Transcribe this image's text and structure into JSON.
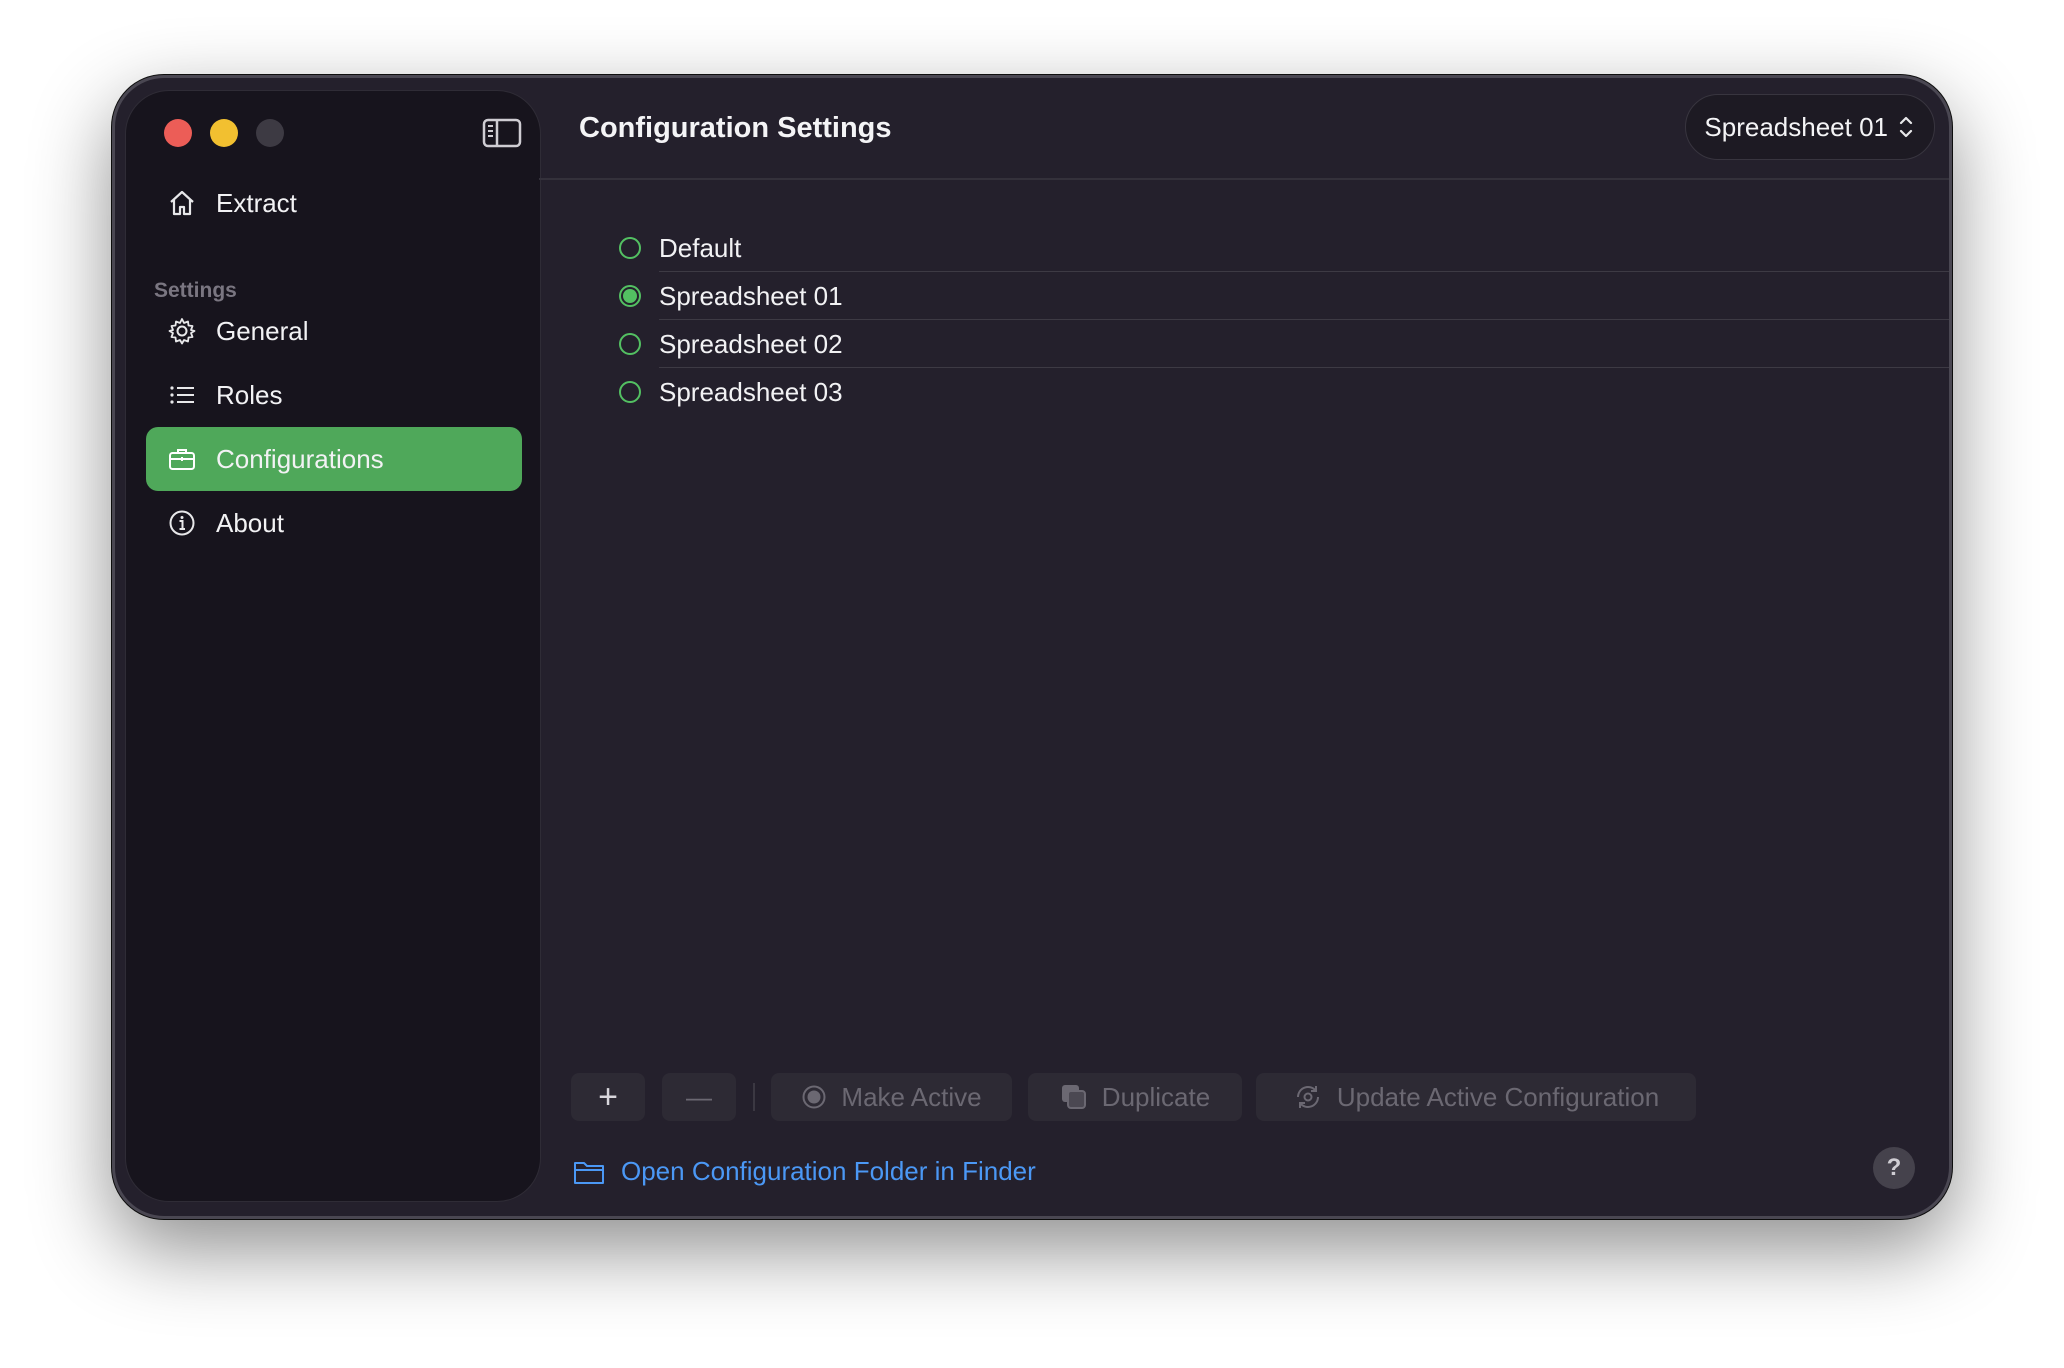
{
  "window": {
    "traffic_lights": [
      "#ec5d57",
      "#f2c030",
      "#3d3a43"
    ],
    "accent": "#4fa85a",
    "link_color": "#4b98f5"
  },
  "sidebar": {
    "top_item": {
      "label": "Extract",
      "icon": "house-icon"
    },
    "section_label": "Settings",
    "items": [
      {
        "label": "General",
        "icon": "gear-icon",
        "active": false
      },
      {
        "label": "Roles",
        "icon": "list-icon",
        "active": false
      },
      {
        "label": "Configurations",
        "icon": "briefcase-icon",
        "active": true
      },
      {
        "label": "About",
        "icon": "info-icon",
        "active": false
      }
    ]
  },
  "header": {
    "title": "Configuration Settings",
    "selector_value": "Spreadsheet 01"
  },
  "configurations": [
    {
      "label": "Default",
      "selected": false
    },
    {
      "label": "Spreadsheet 01",
      "selected": true
    },
    {
      "label": "Spreadsheet 02",
      "selected": false
    },
    {
      "label": "Spreadsheet 03",
      "selected": false
    }
  ],
  "toolbar": {
    "add_label": "+",
    "remove_label": "—",
    "make_active_label": "Make Active",
    "duplicate_label": "Duplicate",
    "update_label": "Update Active Configuration"
  },
  "footer": {
    "open_folder_label": "Open Configuration Folder in Finder",
    "help_label": "?"
  }
}
